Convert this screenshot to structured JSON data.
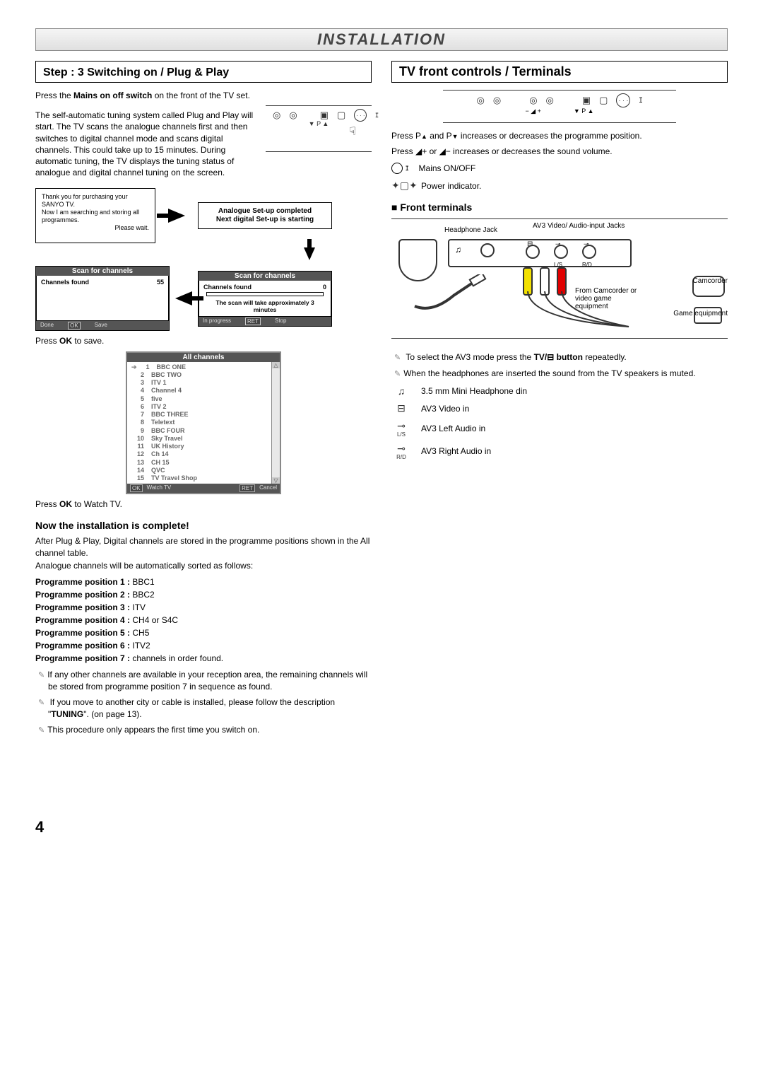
{
  "banner": "INSTALLATION",
  "left": {
    "step_title": "Step : 3  Switching on / Plug & Play",
    "press_mains": "Press the Mains on off switch on the front of the TV set.",
    "self_auto": "The self-automatic tuning system called Plug and Play will start. The TV scans the analogue channels first and then switches to digital channel mode and scans digital channels. This could take up to 15 minutes. During automatic tuning, the TV displays the tuning status of analogue and digital channel tuning on the screen.",
    "thankyou_l1": "Thank you for purchasing your SANYO TV.",
    "thankyou_l2": "Now I am searching and storing all programmes.",
    "thankyou_wait": "Please wait.",
    "analogue_done_l1": "Analogue Set-up completed",
    "analogue_done_l2": "Next digital Set-up is starting",
    "scan_title": "Scan for channels",
    "channels_found": "Channels found",
    "scan_left_count": "55",
    "scan_right_count": "0",
    "scan_time": "The scan will take approximately 3 minutes",
    "scan_footer_done": "Done",
    "scan_footer_ok": "OK",
    "scan_footer_save": "Save",
    "scan_footer_prog": "In progress",
    "scan_footer_ret": "RET",
    "scan_footer_stop": "Stop",
    "press_ok_save": "Press OK to save.",
    "all_channels": "All channels",
    "channels": [
      {
        "n": "1",
        "name": "BBC ONE"
      },
      {
        "n": "2",
        "name": "BBC TWO"
      },
      {
        "n": "3",
        "name": "ITV 1"
      },
      {
        "n": "4",
        "name": "Channel 4"
      },
      {
        "n": "5",
        "name": "five"
      },
      {
        "n": "6",
        "name": "ITV 2"
      },
      {
        "n": "7",
        "name": "BBC THREE"
      },
      {
        "n": "8",
        "name": "Teletext"
      },
      {
        "n": "9",
        "name": "BBC FOUR"
      },
      {
        "n": "10",
        "name": "Sky Travel"
      },
      {
        "n": "11",
        "name": "UK History"
      },
      {
        "n": "12",
        "name": "Ch 14"
      },
      {
        "n": "13",
        "name": "CH 15"
      },
      {
        "n": "14",
        "name": "QVC"
      },
      {
        "n": "15",
        "name": "TV Travel Shop"
      }
    ],
    "chan_btn_ok": "OK",
    "chan_btn_watch": "Watch TV",
    "chan_btn_ret": "RET",
    "chan_btn_cancel": "Cancel",
    "press_ok_watch": "Press OK to Watch TV.",
    "complete_head": "Now the installation is complete!",
    "after_pp": "After Plug & Play, Digital channels are stored in the programme positions shown in the All channel table.",
    "analogue_sort": "Analogue channels will be automatically sorted as follows:",
    "positions": [
      {
        "label": "Programme position 1 :",
        "val": " BBC1"
      },
      {
        "label": "Programme position 2 :",
        "val": " BBC2"
      },
      {
        "label": "Programme position 3 :",
        "val": " ITV"
      },
      {
        "label": "Programme position 4 :",
        "val": " CH4 or S4C"
      },
      {
        "label": "Programme position 5 :",
        "val": " CH5"
      },
      {
        "label": "Programme position 6 :",
        "val": " ITV2"
      },
      {
        "label": "Programme position 7 :",
        "val": " channels in order found."
      }
    ],
    "note1": "If any other channels are available in your reception area, the remaining channels will be stored from programme position 7 in sequence as found.",
    "note2_a": "If you move to another city or cable is installed, please follow the description \"",
    "note2_b": "TUNING",
    "note2_c": "\". (on page 13).",
    "note3": "This procedure only appears the first time you switch on."
  },
  "right": {
    "title": "TV front controls / Terminals",
    "p_row": "▼  P  ▲",
    "vol_row": "−   ◢   +",
    "p_desc_a": "Press P",
    "p_desc_b": " and P",
    "p_desc_c": " increases or decreases the programme position.",
    "vol_desc": "Press ◢+ or ◢− increases or decreases the sound volume.",
    "mains_onoff": "Mains ON/OFF",
    "power_ind": "Power indicator.",
    "front_terminals": "■ Front terminals",
    "hp_jack": "Headphone Jack",
    "av3_jacks": "AV3 Video/ Audio-input Jacks",
    "ls": "L/S",
    "rd": "R/D",
    "from_cam": "From Camcorder or video game equipment",
    "camcorder": "Camcorder",
    "game": "Game equipment",
    "sel_av3_a": "To select the AV3 mode press the ",
    "sel_av3_b": "TV/⊟ button",
    "sel_av3_c": " repeatedly.",
    "hp_mute": "When the headphones are inserted the sound from the TV speakers is muted.",
    "hp_din": "3.5 mm Mini Headphone din",
    "av3_video": "AV3 Video in",
    "av3_left": "AV3 Left Audio in",
    "av3_right": "AV3 Right Audio in"
  },
  "page_number": "4"
}
